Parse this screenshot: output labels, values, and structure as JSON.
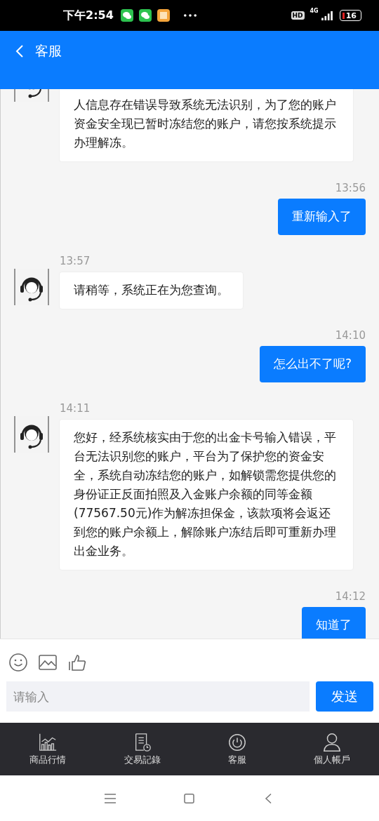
{
  "status_bar": {
    "time": "下午2:54",
    "hd": "HD",
    "network": "4G",
    "battery": "16"
  },
  "header": {
    "title": "客服"
  },
  "messages": [
    {
      "kind": "agent",
      "text": "人信息存在错误导致系统无法识别，为了您的账户资金安全现已暂时冻结您的账户，请您按系统提示办理解冻。"
    },
    {
      "kind": "user",
      "time": "13:56",
      "text": "重新输入了"
    },
    {
      "kind": "agent",
      "time": "13:57",
      "text": "请稍等，系统正在为您查询。"
    },
    {
      "kind": "user",
      "time": "14:10",
      "text": "怎么出不了呢?"
    },
    {
      "kind": "agent",
      "time": "14:11",
      "text": "您好，经系统核实由于您的出金卡号输入错误，平台无法识别您的账户，平台为了保护您的资金安全，系统自动冻结您的账户，如解锁需您提供您的身份证正反面拍照及入金账户余额的同等金额(77567.50元)作为解冻担保金，该款项将会返还到您的账户余额上，解除账户冻结后即可重新办理出金业务。"
    },
    {
      "kind": "user",
      "time": "14:12",
      "text": "知道了"
    }
  ],
  "composer": {
    "placeholder": "请输入",
    "send": "发送"
  },
  "tab_bar": [
    {
      "kind": "chart",
      "label": "商品行情"
    },
    {
      "kind": "record",
      "label": "交易記錄"
    },
    {
      "kind": "service",
      "label": "客服"
    },
    {
      "kind": "person",
      "label": "個人帳戶"
    }
  ]
}
